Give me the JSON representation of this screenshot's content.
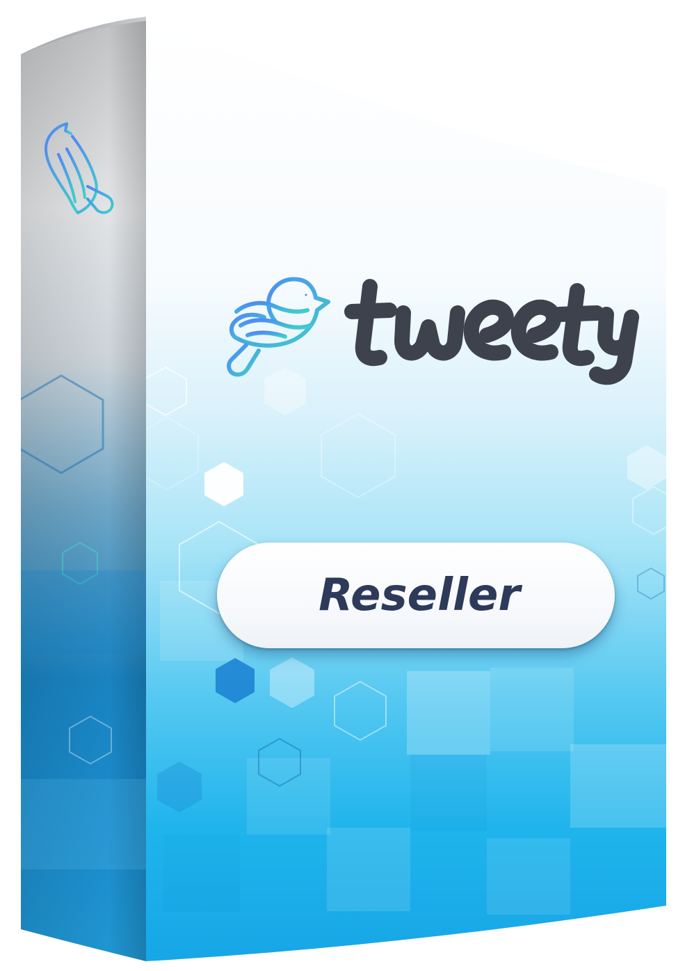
{
  "product": {
    "brand_name": "tweety",
    "edition_label": "Reseller"
  },
  "colors": {
    "logo_gradient_start": "#4f86f7",
    "logo_gradient_end": "#3fd0c9",
    "wordmark": "#3d424c",
    "badge_text": "#2d3a5a",
    "box_blue": "#18a6e8",
    "box_light": "#ffffff"
  },
  "icons": {
    "brand_logo": "bird-icon",
    "spine_logo": "bird-icon"
  }
}
